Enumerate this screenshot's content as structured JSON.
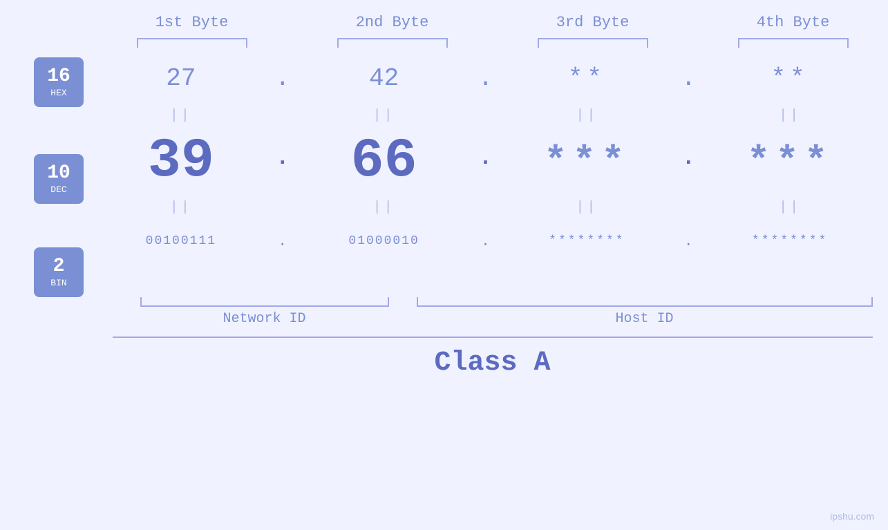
{
  "headers": {
    "byte1": "1st Byte",
    "byte2": "2nd Byte",
    "byte3": "3rd Byte",
    "byte4": "4th Byte"
  },
  "badges": {
    "hex": {
      "num": "16",
      "label": "HEX"
    },
    "dec": {
      "num": "10",
      "label": "DEC"
    },
    "bin": {
      "num": "2",
      "label": "BIN"
    }
  },
  "values": {
    "hex": {
      "b1": "27",
      "b2": "42",
      "b3": "**",
      "b4": "**"
    },
    "dec": {
      "b1": "39",
      "b2": "66",
      "b3": "***",
      "b4": "***"
    },
    "bin": {
      "b1": "00100111",
      "b2": "01000010",
      "b3": "********",
      "b4": "********"
    }
  },
  "dots": {
    "hex": ".",
    "dec": ".",
    "bin": "."
  },
  "equals": "||",
  "labels": {
    "network_id": "Network ID",
    "host_id": "Host ID",
    "class": "Class A"
  },
  "watermark": "ipshu.com",
  "colors": {
    "primary": "#5c6bbf",
    "secondary": "#7b8fd4",
    "light": "#b0bce8",
    "bg": "#f0f2ff"
  }
}
